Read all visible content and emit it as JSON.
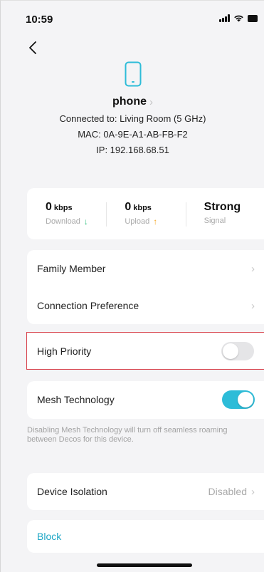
{
  "status_bar": {
    "time": "10:59"
  },
  "device": {
    "name": "phone",
    "connected_to": "Connected to: Living Room (5 GHz)",
    "mac": "MAC: 0A-9E-A1-AB-FB-F2",
    "ip": "IP: 192.168.68.51"
  },
  "stats": {
    "download": {
      "value": "0",
      "unit": "kbps",
      "label": "Download"
    },
    "upload": {
      "value": "0",
      "unit": "kbps",
      "label": "Upload"
    },
    "signal": {
      "value": "Strong",
      "label": "Signal"
    }
  },
  "settings": {
    "family_member": "Family Member",
    "connection_preference": "Connection Preference",
    "high_priority": {
      "label": "High Priority",
      "enabled": false
    },
    "mesh_technology": {
      "label": "Mesh Technology",
      "enabled": true
    },
    "mesh_note": "Disabling Mesh Technology will turn off seamless roaming between Decos for this device.",
    "device_isolation": {
      "label": "Device Isolation",
      "value": "Disabled"
    },
    "block": "Block"
  },
  "colors": {
    "accent": "#2dbcd8",
    "download_arrow": "#2cbf7c",
    "upload_arrow": "#f5a623",
    "highlight_border": "#d8404a"
  }
}
